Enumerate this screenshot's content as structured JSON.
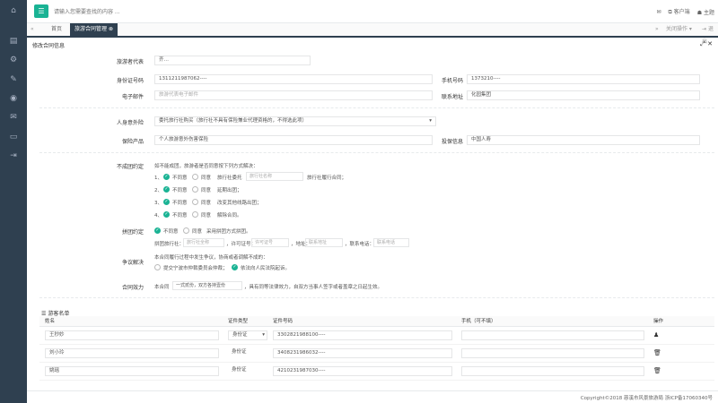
{
  "header": {
    "search_placeholder": "请输入您需要查找的内容 ...",
    "right_items": [
      "客户端",
      "主题"
    ]
  },
  "tabs": {
    "prev": "«",
    "next": "»",
    "items": [
      {
        "label": "首页",
        "active": false
      },
      {
        "label": "旅游合同管理",
        "active": true
      }
    ],
    "close_op": "关闭操作",
    "logout": "退出"
  },
  "panel": {
    "title": "修改合同信息"
  },
  "form": {
    "rep_label": "旅游者代表",
    "rep_value": "齐…",
    "id_label": "身份证号码",
    "id_value": "1311211987062----",
    "phone_label": "手机号码",
    "phone_value": "1373210----",
    "email_label": "电子邮件",
    "email_placeholder": "旅游代表电子邮件",
    "addr_label": "联系地址",
    "addr_value": "化园集团",
    "insure_label": "人身意外险",
    "insure_value": "委托旅行社购买（旅行社不具有保险兼业代理资格的，不得选此项）",
    "product_label": "保险产品",
    "product_value": "个人旅游意外伤害保险",
    "insurer_label": "投保信息",
    "insurer_value": "中国人寿",
    "fail_label": "不成团约定",
    "fail_intro": "如不能成团，旅游者是否同意按下列方式解决：",
    "fail_items": [
      {
        "num": "1、",
        "no": "不同意",
        "yes": "同意",
        "desc": "旅行社委托",
        "ph": "旅行社名称",
        "tail": "旅行社履行合同；"
      },
      {
        "num": "2、",
        "no": "不同意",
        "yes": "同意",
        "desc": "延期出团；",
        "ph": "",
        "tail": ""
      },
      {
        "num": "3、",
        "no": "不同意",
        "yes": "同意",
        "desc": "改变其他线路出团；",
        "ph": "",
        "tail": ""
      },
      {
        "num": "4、",
        "no": "不同意",
        "yes": "同意",
        "desc": "解除合同。",
        "ph": "",
        "tail": ""
      }
    ],
    "group_label": "拼团约定",
    "group_no": "不同意",
    "group_yes": "同意",
    "group_desc": "采用拼团方式拼团。",
    "group_agency_label": "拼团旅行社：",
    "group_agency_ph": "旅行社全称",
    "group_permit_label": "，许可证号：",
    "group_permit_ph": "许可证号",
    "group_addr_label": "，地址：",
    "group_addr_ph": "联系地址",
    "group_tel_label": "，联系电话：",
    "group_tel_ph": "联系电话",
    "dispute_label": "争议解决",
    "dispute_intro": "本合同履行过程中发生争议，协商或者调解不成的：",
    "dispute_opt1": "提交宁波市仲裁委员会仲裁；",
    "dispute_opt2": "依法向人民法院起诉。",
    "effect_label": "合同效力",
    "effect_pre": "本合同",
    "effect_value": "一式贰份，双方各持壹份",
    "effect_post": "，具有同等法律效力，自双方当事人签字或者盖章之日起生效。"
  },
  "tourists": {
    "title": "游客名单",
    "columns": [
      "姓名",
      "证件类型",
      "证件号码",
      "手机（可不填）",
      "操作"
    ],
    "rows": [
      {
        "name": "王秒妙",
        "type": "身份证",
        "id": "3302821988100----",
        "phone": "",
        "action_icon": "user-add-icon"
      },
      {
        "name": "刘小玲",
        "type": "身份证",
        "id": "3408231986032----",
        "phone": "",
        "action_icon": "trash-icon"
      },
      {
        "name": "姚瑶",
        "type": "身份证",
        "id": "4210231987030----",
        "phone": "",
        "action_icon": "trash-icon"
      }
    ]
  },
  "footer": {
    "copyright": "Copyright©2018 慈溪市风景旅游局 浙ICP备17060340号"
  },
  "colors": {
    "sidebar": "#2f4050",
    "accent": "#1ab394"
  }
}
